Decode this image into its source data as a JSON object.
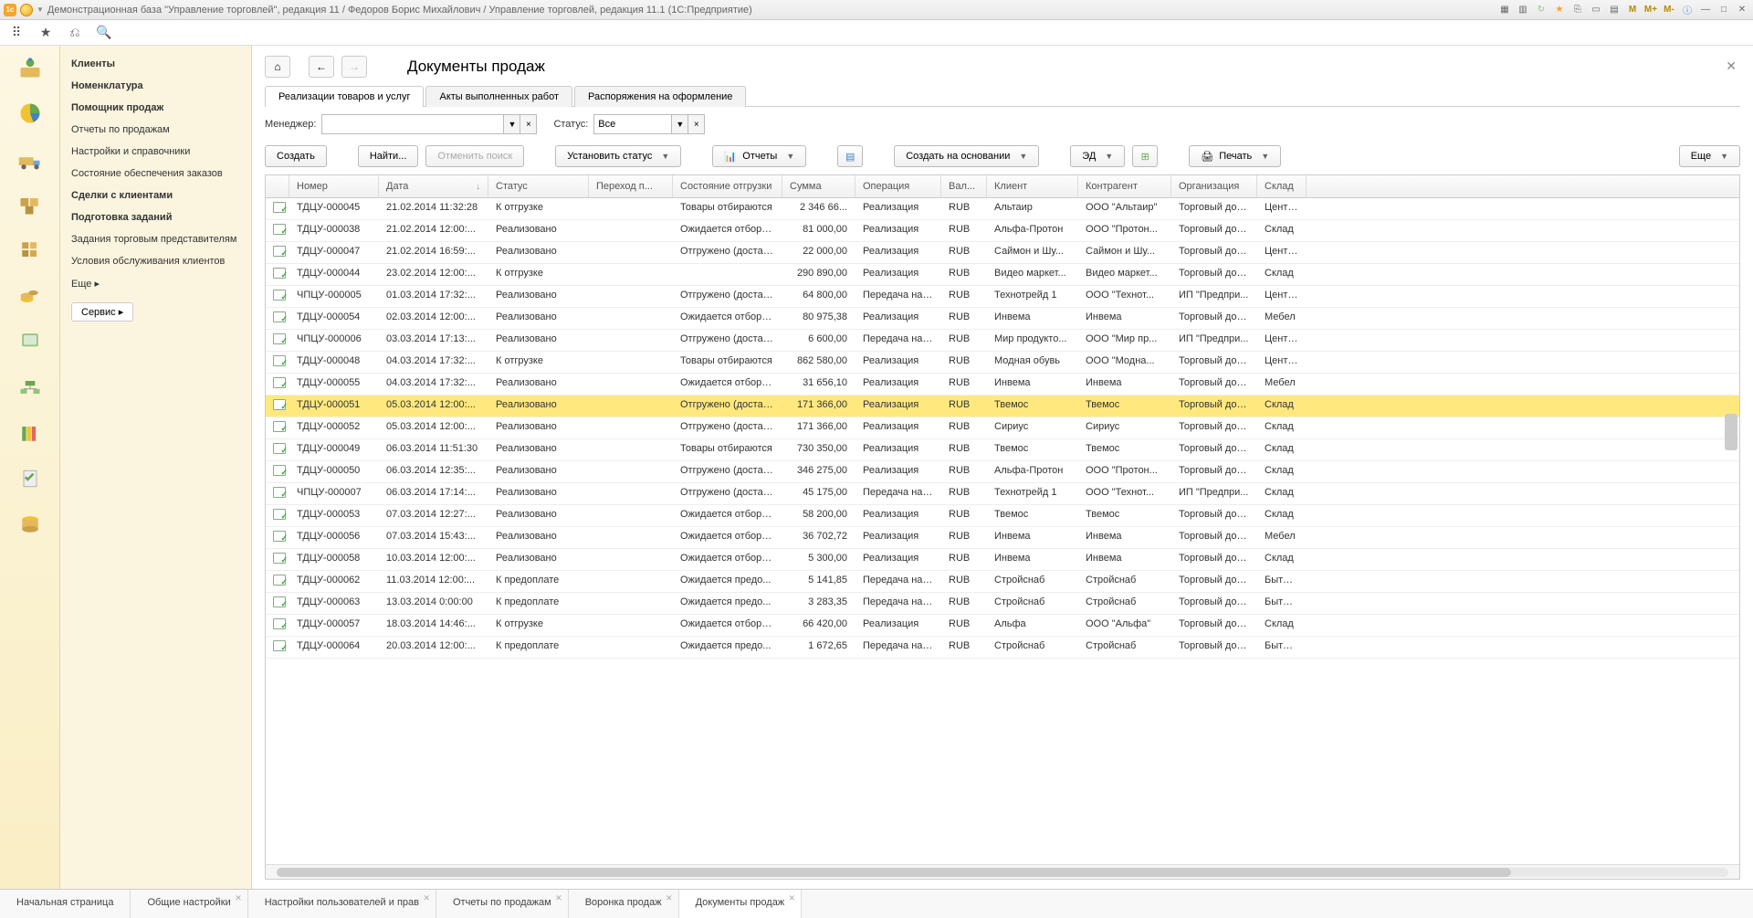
{
  "window_title": "Демонстрационная база \"Управление торговлей\", редакция 11 / Федоров Борис Михайлович / Управление торговлей, редакция 11.1  (1С:Предприятие)",
  "titlebar_buttons": [
    "M",
    "M+",
    "M-"
  ],
  "nav": {
    "items": [
      {
        "label": "Клиенты",
        "bold": true
      },
      {
        "label": "Номенклатура",
        "bold": true
      },
      {
        "label": "Помощник продаж",
        "bold": true
      },
      {
        "label": "Отчеты по продажам",
        "bold": false
      },
      {
        "label": "Настройки и справочники",
        "bold": false
      },
      {
        "label": "Состояние обеспечения заказов",
        "bold": false
      },
      {
        "label": "Сделки с клиентами",
        "bold": true
      },
      {
        "label": "Подготовка заданий",
        "bold": true
      },
      {
        "label": "Задания торговым представителям",
        "bold": false
      },
      {
        "label": "Условия обслуживания клиентов",
        "bold": false
      }
    ],
    "more": "Еще ▸",
    "service": "Сервис ▸"
  },
  "page": {
    "title": "Документы продаж",
    "tabs": [
      {
        "label": "Реализации товаров и услуг",
        "active": true
      },
      {
        "label": "Акты выполненных работ",
        "active": false
      },
      {
        "label": "Распоряжения на оформление",
        "active": false
      }
    ],
    "filters": {
      "manager_label": "Менеджер:",
      "manager_value": "",
      "status_label": "Статус:",
      "status_value": "Все"
    },
    "cmd": {
      "create": "Создать",
      "find": "Найти...",
      "cancel_find": "Отменить поиск",
      "set_status": "Установить статус",
      "reports": "Отчеты",
      "create_based": "Создать на основании",
      "ed": "ЭД",
      "print": "Печать",
      "more": "Еще"
    },
    "columns": [
      "",
      "Номер",
      "Дата",
      "Статус",
      "Переход п...",
      "Состояние отгрузки",
      "Сумма",
      "Операция",
      "Вал...",
      "Клиент",
      "Контрагент",
      "Организация",
      "Склад"
    ],
    "rows": [
      {
        "num": "ТДЦУ-000045",
        "date": "21.02.2014 11:32:28",
        "status": "К отгрузке",
        "trans": "",
        "ship": "Товары отбираются",
        "sum": "2 346 66...",
        "op": "Реализация",
        "cur": "RUB",
        "cli": "Альтаир",
        "ctr": "ООО \"Альтаир\"",
        "org": "Торговый дом...",
        "whs": "Центра"
      },
      {
        "num": "ТДЦУ-000038",
        "date": "21.02.2014 12:00:...",
        "status": "Реализовано",
        "trans": "",
        "ship": "Ожидается отбор т...",
        "sum": "81 000,00",
        "op": "Реализация",
        "cur": "RUB",
        "cli": "Альфа-Протон",
        "ctr": "ООО \"Протон...",
        "org": "Торговый дом...",
        "whs": "Склад"
      },
      {
        "num": "ТДЦУ-000047",
        "date": "21.02.2014 16:59:...",
        "status": "Реализовано",
        "trans": "",
        "ship": "Отгружено (достав...",
        "sum": "22 000,00",
        "op": "Реализация",
        "cur": "RUB",
        "cli": "Саймон и Шу...",
        "ctr": "Саймон и Шу...",
        "org": "Торговый дом...",
        "whs": "Центра"
      },
      {
        "num": "ТДЦУ-000044",
        "date": "23.02.2014 12:00:...",
        "status": "К отгрузке",
        "trans": "",
        "ship": "",
        "sum": "290 890,00",
        "op": "Реализация",
        "cur": "RUB",
        "cli": "Видео маркет...",
        "ctr": "Видео маркет...",
        "org": "Торговый дом...",
        "whs": "Склад"
      },
      {
        "num": "ЧПЦУ-000005",
        "date": "01.03.2014 17:32:...",
        "status": "Реализовано",
        "trans": "",
        "ship": "Отгружено (достав...",
        "sum": "64 800,00",
        "op": "Передача на ...",
        "cur": "RUB",
        "cli": "Технотрейд 1",
        "ctr": "ООО \"Технот...",
        "org": "ИП \"Предпри...",
        "whs": "Центра"
      },
      {
        "num": "ТДЦУ-000054",
        "date": "02.03.2014 12:00:...",
        "status": "Реализовано",
        "trans": "",
        "ship": "Ожидается отбор т...",
        "sum": "80 975,38",
        "op": "Реализация",
        "cur": "RUB",
        "cli": "Инвема",
        "ctr": "Инвема",
        "org": "Торговый дом...",
        "whs": "Мебел"
      },
      {
        "num": "ЧПЦУ-000006",
        "date": "03.03.2014 17:13:...",
        "status": "Реализовано",
        "trans": "",
        "ship": "Отгружено (достав...",
        "sum": "6 600,00",
        "op": "Передача на ...",
        "cur": "RUB",
        "cli": "Мир продукто...",
        "ctr": "ООО \"Мир пр...",
        "org": "ИП \"Предпри...",
        "whs": "Центра"
      },
      {
        "num": "ТДЦУ-000048",
        "date": "04.03.2014 17:32:...",
        "status": "К отгрузке",
        "trans": "",
        "ship": "Товары отбираются",
        "sum": "862 580,00",
        "op": "Реализация",
        "cur": "RUB",
        "cli": "Модная обувь",
        "ctr": "ООО \"Модна...",
        "org": "Торговый дом...",
        "whs": "Центра"
      },
      {
        "num": "ТДЦУ-000055",
        "date": "04.03.2014 17:32:...",
        "status": "Реализовано",
        "trans": "",
        "ship": "Ожидается отбор т...",
        "sum": "31 656,10",
        "op": "Реализация",
        "cur": "RUB",
        "cli": "Инвема",
        "ctr": "Инвема",
        "org": "Торговый дом...",
        "whs": "Мебел"
      },
      {
        "num": "ТДЦУ-000051",
        "date": "05.03.2014 12:00:...",
        "status": "Реализовано",
        "trans": "",
        "ship": "Отгружено (достав...",
        "sum": "171 366,00",
        "op": "Реализация",
        "cur": "RUB",
        "cli": "Твемос",
        "ctr": "Твемос",
        "org": "Торговый дом...",
        "whs": "Склад",
        "sel": true
      },
      {
        "num": "ТДЦУ-000052",
        "date": "05.03.2014 12:00:...",
        "status": "Реализовано",
        "trans": "",
        "ship": "Отгружено (достав...",
        "sum": "171 366,00",
        "op": "Реализация",
        "cur": "RUB",
        "cli": "Сириус",
        "ctr": "Сириус",
        "org": "Торговый дом...",
        "whs": "Склад"
      },
      {
        "num": "ТДЦУ-000049",
        "date": "06.03.2014 11:51:30",
        "status": "Реализовано",
        "trans": "",
        "ship": "Товары отбираются",
        "sum": "730 350,00",
        "op": "Реализация",
        "cur": "RUB",
        "cli": "Твемос",
        "ctr": "Твемос",
        "org": "Торговый дом...",
        "whs": "Склад"
      },
      {
        "num": "ТДЦУ-000050",
        "date": "06.03.2014 12:35:...",
        "status": "Реализовано",
        "trans": "",
        "ship": "Отгружено (достав...",
        "sum": "346 275,00",
        "op": "Реализация",
        "cur": "RUB",
        "cli": "Альфа-Протон",
        "ctr": "ООО \"Протон...",
        "org": "Торговый дом...",
        "whs": "Склад"
      },
      {
        "num": "ЧПЦУ-000007",
        "date": "06.03.2014 17:14:...",
        "status": "Реализовано",
        "trans": "",
        "ship": "Отгружено (достав...",
        "sum": "45 175,00",
        "op": "Передача на ...",
        "cur": "RUB",
        "cli": "Технотрейд 1",
        "ctr": "ООО \"Технот...",
        "org": "ИП \"Предпри...",
        "whs": "Склад"
      },
      {
        "num": "ТДЦУ-000053",
        "date": "07.03.2014 12:27:...",
        "status": "Реализовано",
        "trans": "",
        "ship": "Ожидается отбор т...",
        "sum": "58 200,00",
        "op": "Реализация",
        "cur": "RUB",
        "cli": "Твемос",
        "ctr": "Твемос",
        "org": "Торговый дом...",
        "whs": "Склад"
      },
      {
        "num": "ТДЦУ-000056",
        "date": "07.03.2014 15:43:...",
        "status": "Реализовано",
        "trans": "",
        "ship": "Ожидается отбор т...",
        "sum": "36 702,72",
        "op": "Реализация",
        "cur": "RUB",
        "cli": "Инвема",
        "ctr": "Инвема",
        "org": "Торговый дом...",
        "whs": "Мебел"
      },
      {
        "num": "ТДЦУ-000058",
        "date": "10.03.2014 12:00:...",
        "status": "Реализовано",
        "trans": "",
        "ship": "Ожидается отбор т...",
        "sum": "5 300,00",
        "op": "Реализация",
        "cur": "RUB",
        "cli": "Инвема",
        "ctr": "Инвема",
        "org": "Торговый дом...",
        "whs": "Склад"
      },
      {
        "num": "ТДЦУ-000062",
        "date": "11.03.2014 12:00:...",
        "status": "К предоплате",
        "trans": "",
        "ship": "Ожидается предо...",
        "sum": "5 141,85",
        "op": "Передача на ...",
        "cur": "RUB",
        "cli": "Стройснаб",
        "ctr": "Стройснаб",
        "org": "Торговый дом...",
        "whs": "Бытова"
      },
      {
        "num": "ТДЦУ-000063",
        "date": "13.03.2014 0:00:00",
        "status": "К предоплате",
        "trans": "",
        "ship": "Ожидается предо...",
        "sum": "3 283,35",
        "op": "Передача на ...",
        "cur": "RUB",
        "cli": "Стройснаб",
        "ctr": "Стройснаб",
        "org": "Торговый дом...",
        "whs": "Бытова"
      },
      {
        "num": "ТДЦУ-000057",
        "date": "18.03.2014 14:46:...",
        "status": "К отгрузке",
        "trans": "",
        "ship": "Ожидается отбор т...",
        "sum": "66 420,00",
        "op": "Реализация",
        "cur": "RUB",
        "cli": "Альфа",
        "ctr": "ООО \"Альфа\"",
        "org": "Торговый дом...",
        "whs": "Склад"
      },
      {
        "num": "ТДЦУ-000064",
        "date": "20.03.2014 12:00:...",
        "status": "К предоплате",
        "trans": "",
        "ship": "Ожидается предо...",
        "sum": "1 672,65",
        "op": "Передача на ...",
        "cur": "RUB",
        "cli": "Стройснаб",
        "ctr": "Стройснаб",
        "org": "Торговый дом...",
        "whs": "Бытова"
      }
    ]
  },
  "bottom_tabs": [
    {
      "label": "Начальная страница",
      "active": false
    },
    {
      "label": "Общие настройки",
      "active": false,
      "x": true
    },
    {
      "label": "Настройки пользователей и прав",
      "active": false,
      "x": true
    },
    {
      "label": "Отчеты по продажам",
      "active": false,
      "x": true
    },
    {
      "label": "Воронка продаж",
      "active": false,
      "x": true
    },
    {
      "label": "Документы продаж",
      "active": true,
      "x": true
    }
  ]
}
